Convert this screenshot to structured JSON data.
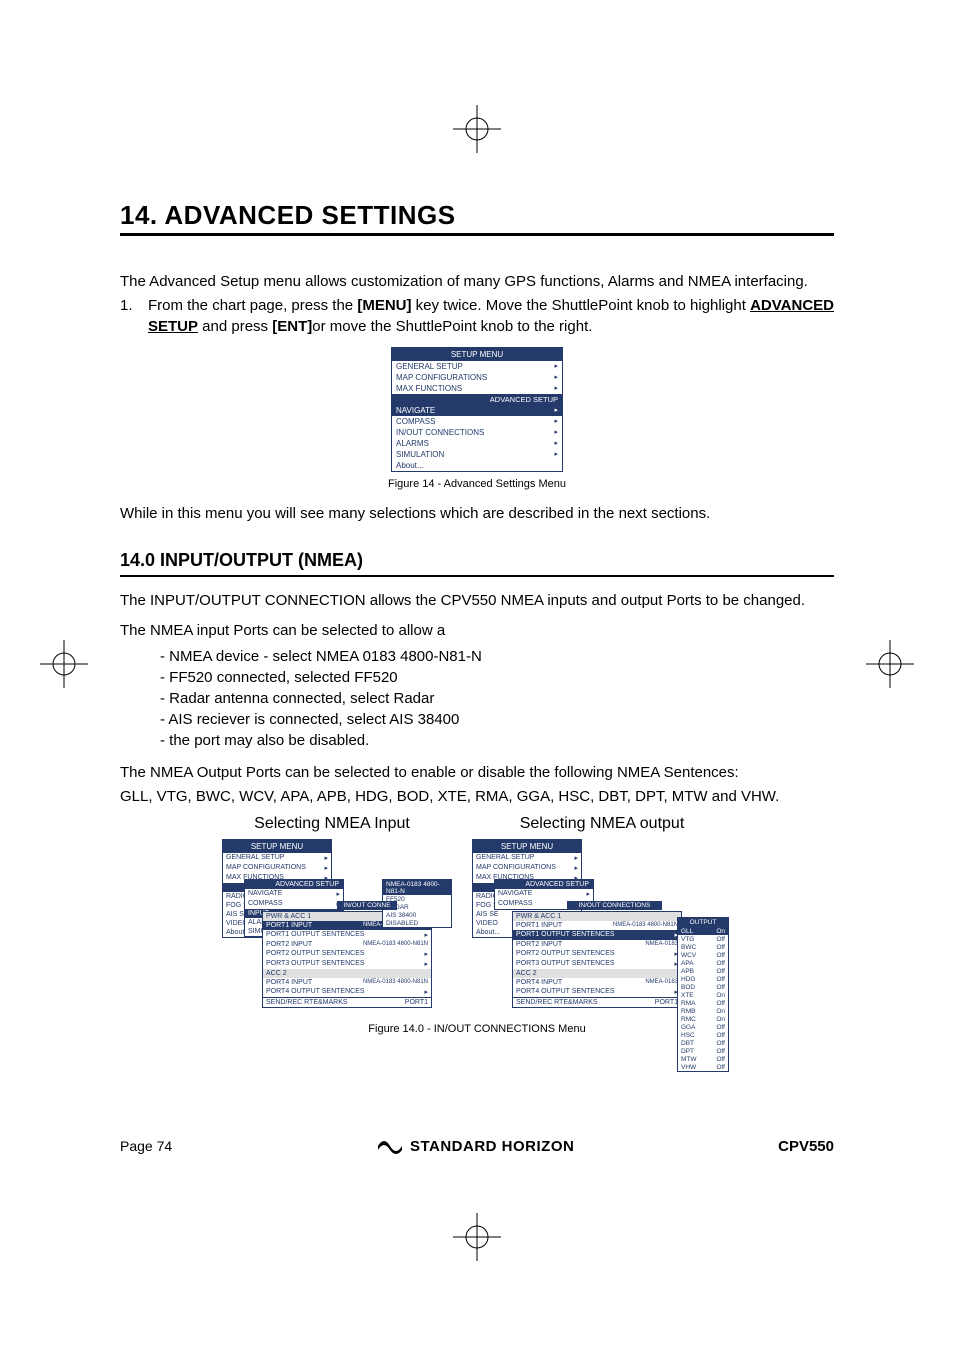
{
  "chapter_title": "14. ADVANCED SETTINGS",
  "intro_text": "The Advanced Setup menu allows customization of many GPS functions, Alarms and NMEA interfacing.",
  "step1_prefix": "1.",
  "step1_a": "From the chart page, press the ",
  "step1_menu": "[MENU]",
  "step1_b": " key twice. Move the ShuttlePoint knob to highlight ",
  "step1_advsetup": "ADVANCED SETUP",
  "step1_c": " and press ",
  "step1_ent": "[ENT]",
  "step1_d": "or move the ShuttlePoint knob to the right.",
  "fig14_caption": "Figure 14 -  Advanced Settings Menu",
  "while_text": "While in this menu you will see many selections which are described in the next sections.",
  "section_title": "14.0   INPUT/OUTPUT (NMEA)",
  "sect_p1": "The INPUT/OUTPUT CONNECTION allows the CPV550 NMEA inputs and output Ports to be changed.",
  "sect_p2": "The NMEA input Ports can be selected to allow a",
  "dash": {
    "d1": "NMEA device - select NMEA 0183 4800-N81-N",
    "d2": "FF520 connected, selected FF520",
    "d3": "Radar antenna connected, select Radar",
    "d4": "AIS reciever is connected, select AIS 38400",
    "d5": "the port may also be disabled."
  },
  "sect_p3": "The NMEA Output Ports can be selected to enable or disable the following NMEA Sentences:",
  "sect_p4": "GLL, VTG, BWC, WCV, APA, APB, HDG, BOD, XTE, RMA, GGA, HSC, DBT, DPT, MTW and VHW.",
  "fig_left_title": "Selecting NMEA Input",
  "fig_right_title": "Selecting NMEA output",
  "fig140_caption": "Figure 14.0 -  IN/OUT CONNECTIONS Menu",
  "footer_page": "Page 74",
  "footer_brand": "STANDARD HORIZON",
  "footer_model": "CPV550",
  "setup_menu": {
    "title": "SETUP MENU",
    "items_top": [
      "GENERAL SETUP",
      "MAP CONFIGURATIONS",
      "MAX FUNCTIONS"
    ],
    "section": "ADVANCED SETUP",
    "items_adv": [
      "NAVIGATE",
      "COMPASS",
      "IN/OUT CONNECTIONS",
      "ALARMS",
      "SIMULATION"
    ],
    "last": "About..."
  },
  "left_panels": {
    "back_items": [
      "NAVI",
      "RADIO",
      "FOG S",
      "AIS SE",
      "VIDEO"
    ],
    "adv_items": [
      "NAVIGATE",
      "COMPASS",
      "INPUT",
      "ALAR",
      "SIMUL"
    ],
    "inout_title": "IN/OUT CONNE",
    "pwr": "PWR & ACC 1",
    "p1i": "PORT1 INPUT",
    "p1o": "PORT1 OUTPUT SENTENCES",
    "p2i": "PORT2 INPUT",
    "p2o": "PORT2 OUTPUT SENTENCES",
    "p3o": "PORT3 OUTPUT SENTENCES",
    "acc2": "ACC 2",
    "p4i": "PORT4 INPUT",
    "p4o": "PORT4 OUTPUT SENTENCES",
    "send": "SEND/REC RTE&MARKS",
    "opt1": "NMEA-0183 4800-N81-N",
    "opt2": "FF520",
    "opt3": "RADAR",
    "opt4": "AIS 38400",
    "opt5": "DISABLED",
    "val_port1": "NMEA-0183 4800-N81N",
    "val_port2": "NMEA-0183 4800-N81N",
    "val_port4": "NMEA-0183 4800-N81N",
    "val_send": "PORT1"
  },
  "right_panels": {
    "out_header": "OUTPUT",
    "val_nmea": "NMEA-0183",
    "val_nmea_long": "NMEA-0183 4800-N81N",
    "sentences": [
      [
        "GLL",
        "On"
      ],
      [
        "VTG",
        "Off"
      ],
      [
        "BWC",
        "Off"
      ],
      [
        "WCV",
        "Off"
      ],
      [
        "APA",
        "Off"
      ],
      [
        "APB",
        "Off"
      ],
      [
        "HDG",
        "Off"
      ],
      [
        "BOD",
        "Off"
      ],
      [
        "XTE",
        "On"
      ],
      [
        "RMA",
        "Off"
      ],
      [
        "RMB",
        "On"
      ],
      [
        "RMC",
        "On"
      ],
      [
        "GGA",
        "Off"
      ],
      [
        "HSC",
        "Off"
      ],
      [
        "DBT",
        "Off"
      ],
      [
        "DPT",
        "Off"
      ],
      [
        "MTW",
        "Off"
      ],
      [
        "VHW",
        "Off"
      ]
    ]
  }
}
